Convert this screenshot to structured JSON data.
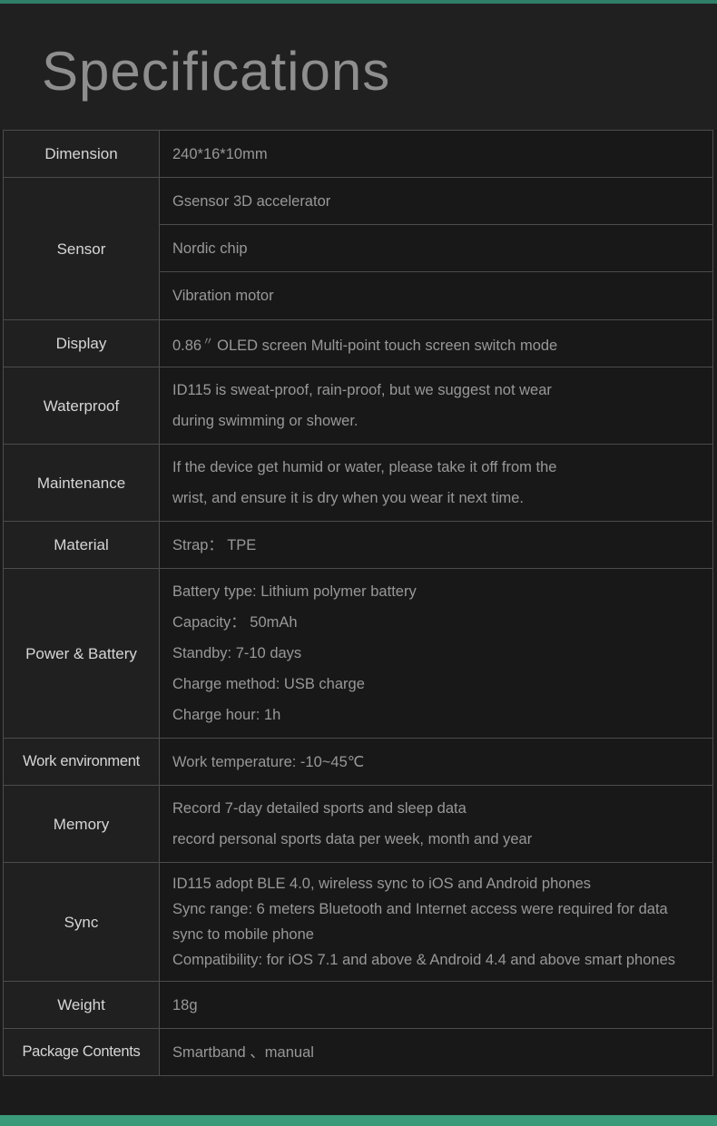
{
  "header": {
    "title": "Specifications"
  },
  "colors": {
    "accent_top": "#2f7e68",
    "accent_bottom": "#3a9a7a",
    "background": "#1b1b1b",
    "label_text": "#d6d6d6",
    "value_text": "#989898",
    "border": "#4c4c4c"
  },
  "rows": [
    {
      "label": "Dimension",
      "lines": [
        "240*16*10mm"
      ]
    },
    {
      "label": "Sensor",
      "subrows": [
        "Gsensor 3D accelerator",
        "Nordic chip",
        "Vibration motor"
      ]
    },
    {
      "label": "Display",
      "display_prefix": "0.86",
      "display_inch": "〃",
      "display_suffix": "OLED screen Multi-point touch screen switch mode"
    },
    {
      "label": "Waterproof",
      "lines": [
        "ID115 is sweat-proof, rain-proof, but we suggest not wear",
        "during swimming or shower."
      ]
    },
    {
      "label": "Maintenance",
      "lines": [
        "If the device get humid or water, please take it off from the",
        "wrist, and ensure it is dry when you wear it next time."
      ]
    },
    {
      "label": "Material",
      "lines": [
        "Strap： TPE"
      ]
    },
    {
      "label": "Power & Battery",
      "lines": [
        "Battery type: Lithium polymer battery",
        "Capacity： 50mAh",
        "Standby: 7-10 days",
        "Charge method: USB charge",
        "Charge hour: 1h"
      ]
    },
    {
      "label": "Work environment",
      "lines": [
        "Work temperature: -10~45℃"
      ]
    },
    {
      "label": "Memory",
      "lines": [
        "Record 7-day detailed sports and sleep data",
        "record personal sports data per week, month and year"
      ]
    },
    {
      "label": "Sync",
      "lines": [
        "ID115 adopt BLE 4.0, wireless sync to iOS and Android phones",
        "Sync range: 6 meters Bluetooth and Internet access were required for data sync to mobile phone",
        "Compatibility: for iOS 7.1 and above & Android 4.4 and above smart phones"
      ]
    },
    {
      "label": "Weight",
      "lines": [
        "18g"
      ]
    },
    {
      "label": "Package Contents",
      "lines": [
        "Smartband 、manual"
      ]
    }
  ]
}
